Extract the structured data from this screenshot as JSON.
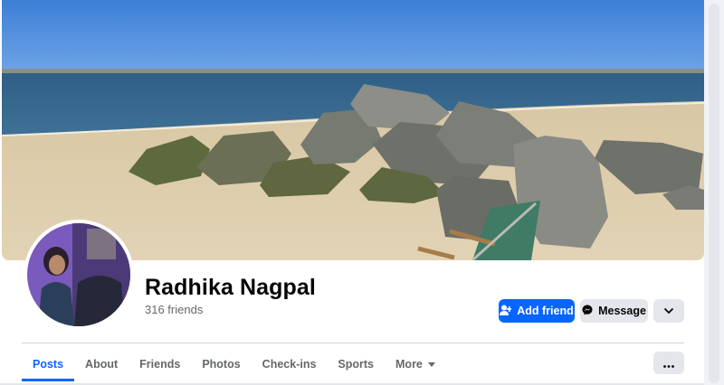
{
  "profile": {
    "name": "Radhika Nagpal",
    "friends": "316 friends"
  },
  "actions": {
    "add_friend": "Add friend",
    "message": "Message"
  },
  "tabs": [
    {
      "label": "Posts",
      "active": true
    },
    {
      "label": "About",
      "active": false
    },
    {
      "label": "Friends",
      "active": false
    },
    {
      "label": "Photos",
      "active": false
    },
    {
      "label": "Check-ins",
      "active": false
    },
    {
      "label": "Sports",
      "active": false
    },
    {
      "label": "More",
      "active": false
    }
  ],
  "colors": {
    "accent": "#0866ff",
    "secondary_button": "#e4e6eb",
    "muted_text": "#65676b"
  },
  "icons": {
    "add_friend": "person-plus-icon",
    "message": "messenger-icon",
    "dropdown": "chevron-down-icon",
    "more_tab": "caret-down-icon",
    "overflow": "ellipsis-icon"
  }
}
